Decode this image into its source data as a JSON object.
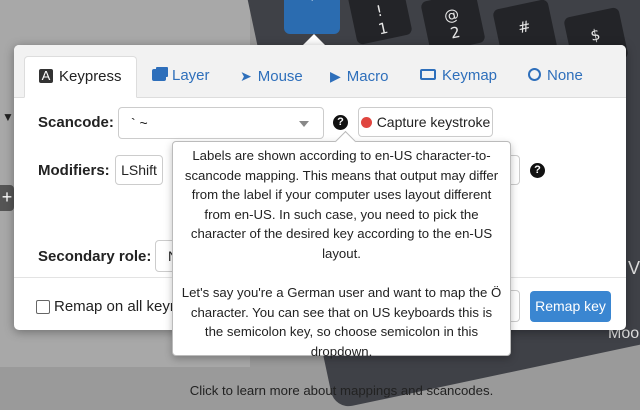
{
  "tabs": [
    {
      "label": "Keypress",
      "icon": "keypress-icon"
    },
    {
      "label": "Layer",
      "icon": "layer-icon"
    },
    {
      "label": "Mouse",
      "icon": "mouse-pointer-icon"
    },
    {
      "label": "Macro",
      "icon": "macro-play-icon"
    },
    {
      "label": "Keymap",
      "icon": "keyboard-icon"
    },
    {
      "label": "None",
      "icon": "ban-icon"
    }
  ],
  "keypress_tab_glyph": "A",
  "scancode": {
    "label": "Scancode:",
    "value": "` ~",
    "capture_label": "Capture keystroke"
  },
  "modifiers": {
    "label": "Modifiers:",
    "first": "LShift",
    "last_partial": "r"
  },
  "secondary_role": {
    "label": "Secondary role:",
    "value_partial": "N"
  },
  "footer": {
    "remap_all_label": "Remap on all keym",
    "cancel_partial": "l",
    "remap_key_label": "Remap key"
  },
  "help_icon_glyph": "?",
  "popover": {
    "p1": "Labels are shown according to en-US character-to-scancode mapping. This means that output may differ from the label if your computer uses layout different from en-US. In such case, you need to pick the character of the desired key according to the en-US layout.",
    "p2": "Let's say you're a German user and want to map the Ö character. You can see that on US keyboards this is the semicolon key, so choose semicolon in this dropdown.",
    "p3": "Click to learn more about mappings and scancodes."
  },
  "background_keys": {
    "active": "`",
    "k1_top": "!",
    "k1_bottom": "1",
    "k2_top": "@",
    "k2_bottom": "2",
    "k3_top": "#",
    "k4_top": "$",
    "edge_text_1": "V",
    "edge_text_2": "Moo"
  },
  "colors": {
    "accent": "#2e6fbb",
    "primary_button": "#3a86d1",
    "record_dot": "#e0453f",
    "active_key": "#2b6cb0"
  }
}
